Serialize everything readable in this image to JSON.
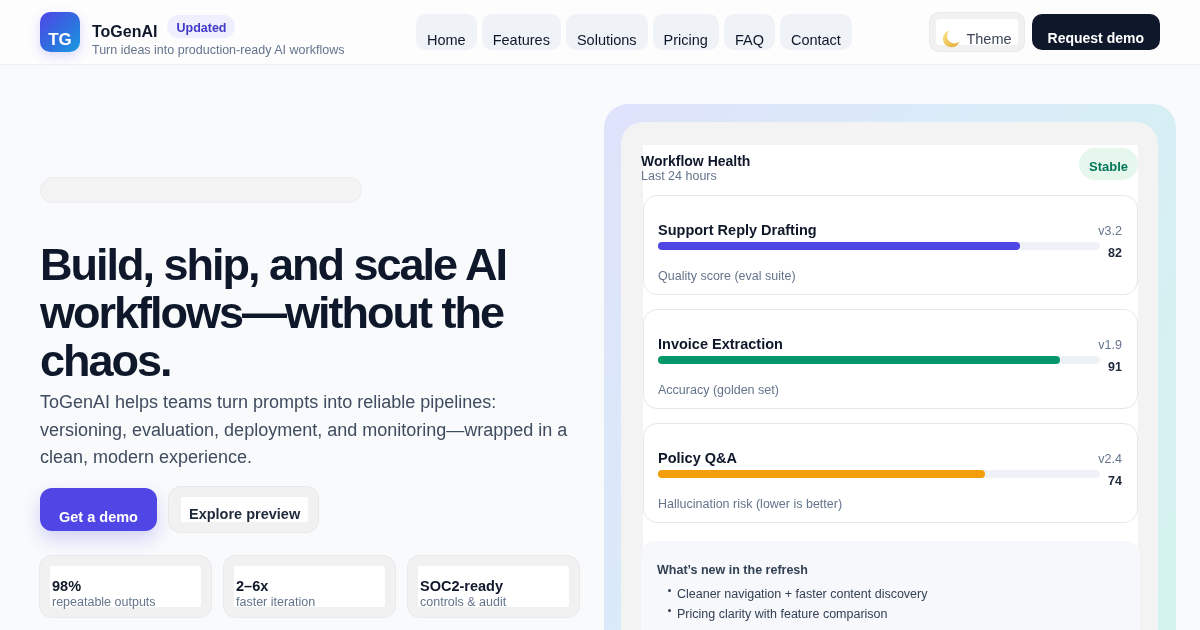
{
  "header": {
    "logo_text": "TG",
    "brand": "ToGenAI",
    "badge": "Updated",
    "tagline": "Turn ideas into production-ready AI workflows",
    "nav": [
      {
        "label": "Home"
      },
      {
        "label": "Features"
      },
      {
        "label": "Solutions"
      },
      {
        "label": "Pricing"
      },
      {
        "label": "FAQ"
      },
      {
        "label": "Contact"
      }
    ],
    "theme_button": "Theme",
    "cta": "Request demo"
  },
  "hero": {
    "title": "Build, ship, and scale AI workflows—without the chaos.",
    "description": "ToGenAI helps teams turn prompts into reliable pipelines: versioning, evaluation, deployment, and monitoring—wrapped in a clean, modern experience.",
    "buttons": [
      {
        "label": "Get a demo",
        "kind": "primary"
      },
      {
        "label": "Explore preview",
        "kind": "secondary"
      }
    ],
    "stats": [
      {
        "value": "98%",
        "label": "repeatable outputs"
      },
      {
        "value": "2–6x",
        "label": "faster iteration"
      },
      {
        "value": "SOC2-ready",
        "label": "controls & audit"
      }
    ]
  },
  "panel": {
    "title": "Workflow Health",
    "subtitle": "Last 24 hours",
    "status": "Stable",
    "metrics": [
      {
        "name": "Support Reply Drafting",
        "version": "v3.2",
        "level": 0.82,
        "value": "82",
        "caption": "Quality score (eval suite)",
        "color": "#4f46e5"
      },
      {
        "name": "Invoice Extraction",
        "version": "v1.9",
        "level": 0.91,
        "value": "91",
        "caption": "Accuracy (golden set)",
        "color": "#059669"
      },
      {
        "name": "Policy Q&A",
        "version": "v2.4",
        "level": 0.74,
        "value": "74",
        "caption": "Hallucination risk (lower is better)",
        "color": "#f59e0b"
      }
    ],
    "whats_new": {
      "title": "What’s new in the refresh",
      "items": [
        "Cleaner navigation + faster content discovery",
        "Pricing clarity with feature comparison"
      ]
    }
  }
}
